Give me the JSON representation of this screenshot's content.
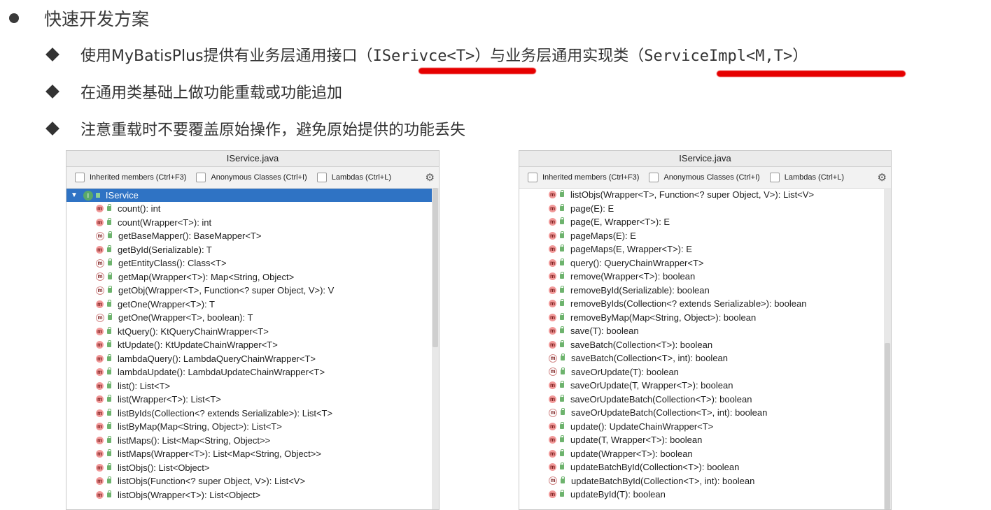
{
  "slide": {
    "heading": "快速开发方案",
    "point1_pre": "使用MyBatisPlus提供有业务层通用接口（",
    "point1_code1": "ISerivce<T>",
    "point1_mid": "）与业务层通用实现类（",
    "point1_code2": "ServiceImpl<M,T>",
    "point1_post": "）",
    "point2": "在通用类基础上做功能重载或功能追加",
    "point3": "注意重载时不要覆盖原始操作，避免原始提供的功能丢失",
    "accent_color": "#e60000"
  },
  "left_panel": {
    "title": "IService.java",
    "filters": [
      "Inherited members (Ctrl+F3)",
      "Anonymous Classes (Ctrl+I)",
      "Lambdas (Ctrl+L)"
    ],
    "root": "IService",
    "selected_color": "#2f73c4",
    "methods": [
      {
        "name": "count(): int",
        "abstract": false
      },
      {
        "name": "count(Wrapper<T>): int",
        "abstract": false
      },
      {
        "name": "getBaseMapper(): BaseMapper<T>",
        "abstract": true
      },
      {
        "name": "getById(Serializable): T",
        "abstract": false
      },
      {
        "name": "getEntityClass(): Class<T>",
        "abstract": true
      },
      {
        "name": "getMap(Wrapper<T>): Map<String, Object>",
        "abstract": true
      },
      {
        "name": "getObj(Wrapper<T>, Function<? super Object, V>): V",
        "abstract": true
      },
      {
        "name": "getOne(Wrapper<T>): T",
        "abstract": false
      },
      {
        "name": "getOne(Wrapper<T>, boolean): T",
        "abstract": true
      },
      {
        "name": "ktQuery(): KtQueryChainWrapper<T>",
        "abstract": false
      },
      {
        "name": "ktUpdate(): KtUpdateChainWrapper<T>",
        "abstract": false
      },
      {
        "name": "lambdaQuery(): LambdaQueryChainWrapper<T>",
        "abstract": false
      },
      {
        "name": "lambdaUpdate(): LambdaUpdateChainWrapper<T>",
        "abstract": false
      },
      {
        "name": "list(): List<T>",
        "abstract": false
      },
      {
        "name": "list(Wrapper<T>): List<T>",
        "abstract": false
      },
      {
        "name": "listByIds(Collection<? extends Serializable>): List<T>",
        "abstract": false
      },
      {
        "name": "listByMap(Map<String, Object>): List<T>",
        "abstract": false
      },
      {
        "name": "listMaps(): List<Map<String, Object>>",
        "abstract": false
      },
      {
        "name": "listMaps(Wrapper<T>): List<Map<String, Object>>",
        "abstract": false
      },
      {
        "name": "listObjs(): List<Object>",
        "abstract": false
      },
      {
        "name": "listObjs(Function<? super Object, V>): List<V>",
        "abstract": false
      },
      {
        "name": "listObjs(Wrapper<T>): List<Object>",
        "abstract": false
      }
    ]
  },
  "right_panel": {
    "title": "IService.java",
    "filters": [
      "Inherited members (Ctrl+F3)",
      "Anonymous Classes (Ctrl+I)",
      "Lambdas (Ctrl+L)"
    ],
    "methods": [
      {
        "name": "listObjs(Wrapper<T>, Function<? super Object, V>): List<V>",
        "abstract": false
      },
      {
        "name": "page(E): E",
        "abstract": false
      },
      {
        "name": "page(E, Wrapper<T>): E",
        "abstract": false
      },
      {
        "name": "pageMaps(E): E",
        "abstract": false
      },
      {
        "name": "pageMaps(E, Wrapper<T>): E",
        "abstract": false
      },
      {
        "name": "query(): QueryChainWrapper<T>",
        "abstract": false
      },
      {
        "name": "remove(Wrapper<T>): boolean",
        "abstract": false
      },
      {
        "name": "removeById(Serializable): boolean",
        "abstract": false
      },
      {
        "name": "removeByIds(Collection<? extends Serializable>): boolean",
        "abstract": false
      },
      {
        "name": "removeByMap(Map<String, Object>): boolean",
        "abstract": false
      },
      {
        "name": "save(T): boolean",
        "abstract": false
      },
      {
        "name": "saveBatch(Collection<T>): boolean",
        "abstract": false
      },
      {
        "name": "saveBatch(Collection<T>, int): boolean",
        "abstract": true
      },
      {
        "name": "saveOrUpdate(T): boolean",
        "abstract": true
      },
      {
        "name": "saveOrUpdate(T, Wrapper<T>): boolean",
        "abstract": false
      },
      {
        "name": "saveOrUpdateBatch(Collection<T>): boolean",
        "abstract": false
      },
      {
        "name": "saveOrUpdateBatch(Collection<T>, int): boolean",
        "abstract": true
      },
      {
        "name": "update(): UpdateChainWrapper<T>",
        "abstract": false
      },
      {
        "name": "update(T, Wrapper<T>): boolean",
        "abstract": false
      },
      {
        "name": "update(Wrapper<T>): boolean",
        "abstract": false
      },
      {
        "name": "updateBatchById(Collection<T>): boolean",
        "abstract": false
      },
      {
        "name": "updateBatchById(Collection<T>, int): boolean",
        "abstract": true
      },
      {
        "name": "updateById(T): boolean",
        "abstract": false
      }
    ]
  }
}
